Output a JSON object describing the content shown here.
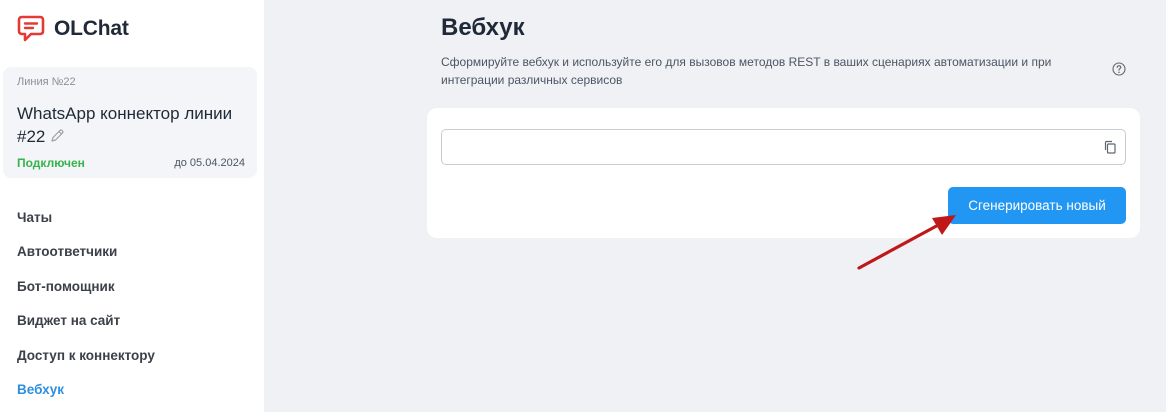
{
  "app": {
    "brand": "OLChat",
    "brand_color": "#e53935"
  },
  "sidebar": {
    "line_card": {
      "number": "Линия №22",
      "name": "WhatsApp коннектор линии #22",
      "status": "Подключен",
      "status_color": "#36b34a",
      "until": "до 05.04.2024"
    },
    "items": [
      {
        "label": "Чаты",
        "active": false
      },
      {
        "label": "Автоответчики",
        "active": false
      },
      {
        "label": "Бот-помощник",
        "active": false
      },
      {
        "label": "Виджет на сайт",
        "active": false
      },
      {
        "label": "Доступ к коннектору",
        "active": false
      },
      {
        "label": "Вебхук",
        "active": true
      }
    ],
    "active_color": "#2f8fdf"
  },
  "main": {
    "title": "Вебхук",
    "description": "Сформируйте вебхук и используйте его для вызовов методов REST в ваших сценариях автоматизации и при интеграции различных сервисов",
    "help_icon": "question-circle-icon",
    "webhook": {
      "value": "",
      "placeholder": "",
      "copy_icon": "copy-icon"
    },
    "generate_button": {
      "label": "Сгенерировать новый",
      "color": "#2196f3"
    },
    "annotation_arrow_color": "#c01818"
  }
}
